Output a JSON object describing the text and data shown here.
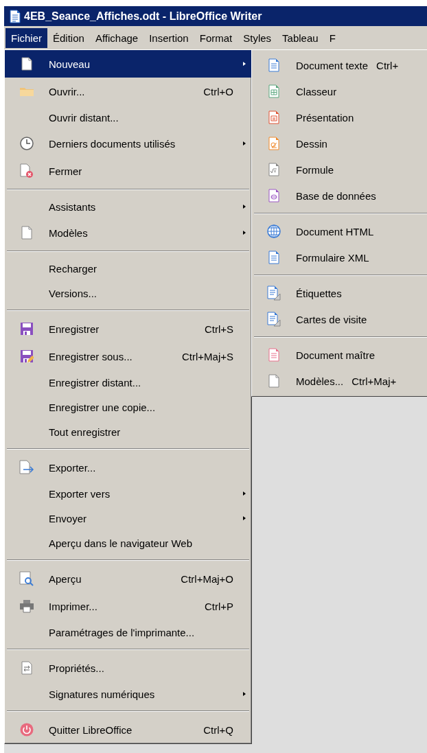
{
  "window": {
    "title": "4EB_Seance_Affiches.odt - LibreOffice Writer"
  },
  "menubar": [
    {
      "label": "Fichier",
      "selected": true
    },
    {
      "label": "Édition",
      "selected": false
    },
    {
      "label": "Affichage",
      "selected": false
    },
    {
      "label": "Insertion",
      "selected": false
    },
    {
      "label": "Format",
      "selected": false
    },
    {
      "label": "Styles",
      "selected": false
    },
    {
      "label": "Tableau",
      "selected": false
    },
    {
      "label": "F",
      "selected": false
    }
  ],
  "menu": {
    "items": [
      {
        "kind": "item",
        "label": "Nouveau",
        "submenu": true,
        "selected": true
      },
      {
        "kind": "item",
        "label": "Ouvrir...",
        "shortcut": "Ctrl+O",
        "submenu": false,
        "selected": false
      },
      {
        "kind": "item",
        "label": "Ouvrir distant...",
        "submenu": false,
        "selected": false
      },
      {
        "kind": "item",
        "label": "Derniers documents utilisés",
        "submenu": true,
        "selected": false
      },
      {
        "kind": "item",
        "label": "Fermer",
        "submenu": false,
        "selected": false
      },
      {
        "kind": "separator"
      },
      {
        "kind": "item",
        "label": "Assistants",
        "submenu": true,
        "selected": false
      },
      {
        "kind": "item",
        "label": "Modèles",
        "submenu": true,
        "selected": false
      },
      {
        "kind": "separator"
      },
      {
        "kind": "item",
        "label": "Recharger",
        "submenu": false,
        "selected": false
      },
      {
        "kind": "item",
        "label": "Versions...",
        "submenu": false,
        "selected": false
      },
      {
        "kind": "separator"
      },
      {
        "kind": "item",
        "label": "Enregistrer",
        "shortcut": "Ctrl+S",
        "submenu": false,
        "selected": false
      },
      {
        "kind": "item",
        "label": "Enregistrer sous...",
        "shortcut": "Ctrl+Maj+S",
        "submenu": false,
        "selected": false
      },
      {
        "kind": "item",
        "label": "Enregistrer distant...",
        "submenu": false,
        "selected": false
      },
      {
        "kind": "item",
        "label": "Enregistrer une copie...",
        "submenu": false,
        "selected": false
      },
      {
        "kind": "item",
        "label": "Tout enregistrer",
        "submenu": false,
        "selected": false
      },
      {
        "kind": "separator"
      },
      {
        "kind": "item",
        "label": "Exporter...",
        "submenu": false,
        "selected": false
      },
      {
        "kind": "item",
        "label": "Exporter vers",
        "submenu": true,
        "selected": false
      },
      {
        "kind": "item",
        "label": "Envoyer",
        "submenu": true,
        "selected": false
      },
      {
        "kind": "item",
        "label": "Aperçu dans le navigateur Web",
        "submenu": false,
        "selected": false
      },
      {
        "kind": "separator"
      },
      {
        "kind": "item",
        "label": "Aperçu",
        "shortcut": "Ctrl+Maj+O",
        "submenu": false,
        "selected": false
      },
      {
        "kind": "item",
        "label": "Imprimer...",
        "shortcut": "Ctrl+P",
        "submenu": false,
        "selected": false
      },
      {
        "kind": "item",
        "label": "Paramétrages de l'imprimante...",
        "submenu": false,
        "selected": false
      },
      {
        "kind": "separator"
      },
      {
        "kind": "item",
        "label": "Propriétés...",
        "submenu": false,
        "selected": false
      },
      {
        "kind": "item",
        "label": "Signatures numériques",
        "submenu": true,
        "selected": false
      },
      {
        "kind": "separator"
      },
      {
        "kind": "item",
        "label": "Quitter LibreOffice",
        "shortcut": "Ctrl+Q",
        "submenu": false,
        "selected": false
      }
    ]
  },
  "submenu": {
    "items": [
      {
        "kind": "item",
        "label": "Document texte",
        "shortcut": "Ctrl+"
      },
      {
        "kind": "item",
        "label": "Classeur"
      },
      {
        "kind": "item",
        "label": "Présentation"
      },
      {
        "kind": "item",
        "label": "Dessin"
      },
      {
        "kind": "item",
        "label": "Formule"
      },
      {
        "kind": "item",
        "label": "Base de données"
      },
      {
        "kind": "separator"
      },
      {
        "kind": "item",
        "label": "Document HTML"
      },
      {
        "kind": "item",
        "label": "Formulaire XML"
      },
      {
        "kind": "separator"
      },
      {
        "kind": "item",
        "label": "Étiquettes"
      },
      {
        "kind": "item",
        "label": "Cartes de visite"
      },
      {
        "kind": "separator"
      },
      {
        "kind": "item",
        "label": "Document maître"
      },
      {
        "kind": "item",
        "label": "Modèles...",
        "shortcut": "Ctrl+Maj+"
      }
    ]
  }
}
